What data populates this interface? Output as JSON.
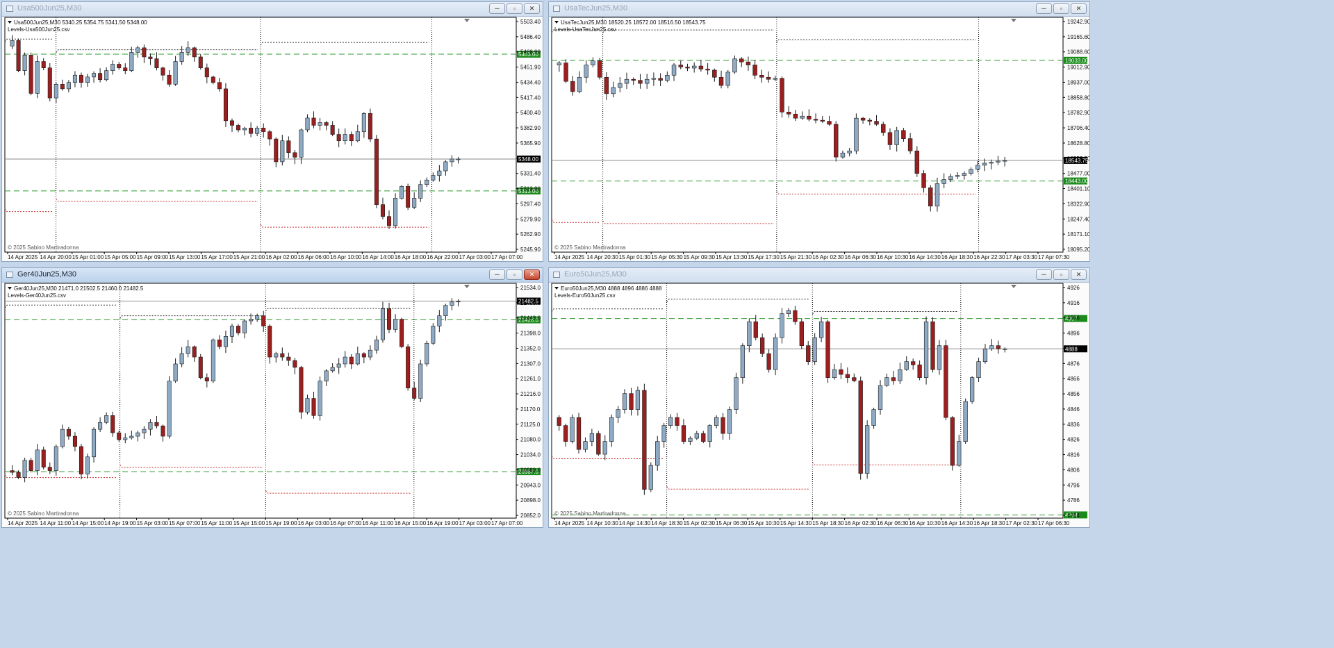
{
  "colors": {
    "bull_fill": "#8eaac4",
    "bear_fill": "#9b1f1f",
    "candle_outline": "#1a1a1a",
    "level_line": "#2e9a2e",
    "level_tag": "#1a8a1a",
    "price_tag": "#000000",
    "chart_bg": "#ffffff",
    "grid": "#000000",
    "upper_band": "#333333",
    "lower_band": "#c83030",
    "bid_line": "#8a8a8a"
  },
  "icons": {
    "window": "window-icon",
    "minimize": "minimize-icon",
    "restore": "restore-icon",
    "close": "close-icon",
    "menu": "triangle-down-icon"
  },
  "windows": [
    {
      "title": "Usa500Jun25,M30",
      "active": false,
      "buttons": {
        "min": "─",
        "max": "▫",
        "close": "✕"
      },
      "header": "Usa500Jun25,M30  5340.25 5354.75 5341.50 5348.00",
      "indicator": "Levels-Usa500Jun25.csv",
      "copyright": "© 2025 Sabino Martiradonna",
      "chart_data": {
        "type": "candlestick",
        "ylim": [
          5245.9,
          5503.4
        ],
        "yticks": [
          "5503.40",
          "5486.40",
          "5468.90",
          "5451.90",
          "5434.40",
          "5417.40",
          "5400.40",
          "5382.90",
          "5365.90",
          "5348.90",
          "5331.40",
          "5313.90",
          "5297.40",
          "5279.90",
          "5262.90",
          "5245.90"
        ],
        "xticks": [
          "14 Apr 2025",
          "14 Apr 20:00",
          "15 Apr 01:00",
          "15 Apr 05:00",
          "15 Apr 09:00",
          "15 Apr 13:00",
          "15 Apr 17:00",
          "15 Apr 21:00",
          "16 Apr 02:00",
          "16 Apr 06:00",
          "16 Apr 10:00",
          "16 Apr 14:00",
          "16 Apr 18:00",
          "16 Apr 22:00",
          "17 Apr 03:00",
          "17 Apr 07:00"
        ],
        "levels": [
          {
            "value": 5463.0,
            "label": "5463.00"
          },
          {
            "value": 5313.0,
            "label": "5313.00"
          }
        ],
        "last_price": {
          "value": 5348.0,
          "label": "5348.00"
        },
        "session_separators": [
          0.1,
          0.5,
          0.835
        ],
        "path": [
          5478,
          5445,
          5462,
          5420,
          5455,
          5448,
          5415,
          5430,
          5425,
          5432,
          5440,
          5432,
          5438,
          5442,
          5435,
          5445,
          5452,
          5448,
          5445,
          5465,
          5470,
          5460,
          5458,
          5448,
          5440,
          5430,
          5455,
          5465,
          5470,
          5460,
          5448,
          5438,
          5432,
          5425,
          5390,
          5385,
          5380,
          5382,
          5376,
          5382,
          5378,
          5370,
          5345,
          5368,
          5355,
          5350,
          5380,
          5393,
          5385,
          5388,
          5385,
          5375,
          5368,
          5375,
          5368,
          5378,
          5398,
          5370,
          5298,
          5285,
          5275,
          5305,
          5318,
          5295,
          5305,
          5320,
          5325,
          5330,
          5335,
          5345,
          5348,
          5348
        ],
        "first_open": 5472
      }
    },
    {
      "title": "UsaTecJun25,M30",
      "active": false,
      "buttons": {
        "min": "─",
        "max": "▫",
        "close": "✕"
      },
      "header": "UsaTecJun25,M30  18520.25 18572.00 18516.50 18543.75",
      "indicator": "Levels-UsaTecJun25.csv",
      "copyright": "© 2025 Sabino Martiradonna",
      "chart_data": {
        "type": "candlestick",
        "ylim": [
          18095.2,
          19242.9
        ],
        "yticks": [
          "19242.90",
          "19165.60",
          "19088.60",
          "19012.90",
          "18937.00",
          "18858.80",
          "18782.90",
          "18706.40",
          "18628.80",
          "18553.30",
          "18477.00",
          "18401.10",
          "18322.90",
          "18247.40",
          "18171.10",
          "18095.20"
        ],
        "xticks": [
          "14 Apr 2025",
          "14 Apr 20:30",
          "15 Apr 01:30",
          "15 Apr 05:30",
          "15 Apr 09:30",
          "15 Apr 13:30",
          "15 Apr 17:30",
          "15 Apr 21:30",
          "16 Apr 02:30",
          "16 Apr 06:30",
          "16 Apr 10:30",
          "16 Apr 14:30",
          "16 Apr 18:30",
          "16 Apr 22:30",
          "17 Apr 03:30",
          "17 Apr 07:30"
        ],
        "levels": [
          {
            "value": 19033.0,
            "label": "19033.00"
          },
          {
            "value": 18443.0,
            "label": "18443.00"
          }
        ],
        "last_price": {
          "value": 18543.75,
          "label": "18543.75"
        },
        "session_separators": [
          0.1,
          0.44,
          0.835
        ],
        "path": [
          19020,
          18930,
          18880,
          18950,
          19010,
          19030,
          18950,
          18870,
          18900,
          18920,
          18940,
          18935,
          18920,
          18940,
          18945,
          18935,
          18960,
          19010,
          19000,
          18995,
          19005,
          18990,
          18985,
          18950,
          18910,
          18975,
          19040,
          19025,
          19010,
          18960,
          18950,
          18940,
          18945,
          18780,
          18770,
          18750,
          18760,
          18745,
          18740,
          18735,
          18720,
          18560,
          18580,
          18590,
          18750,
          18740,
          18735,
          18720,
          18680,
          18620,
          18690,
          18650,
          18590,
          18480,
          18410,
          18320,
          18430,
          18450,
          18465,
          18470,
          18480,
          18500,
          18520,
          18530,
          18535,
          18540,
          18543
        ],
        "first_open": 19010
      }
    },
    {
      "title": "Ger40Jun25,M30",
      "active": true,
      "buttons": {
        "min": "─",
        "max": "▫",
        "close": "✕"
      },
      "header": "Ger40Jun25,M30  21471.0 21502.5 21460.0 21482.5",
      "indicator": "Levels-Ger40Jun25.csv",
      "copyright": "© 2025 Sabino Martiradonna",
      "chart_data": {
        "type": "candlestick",
        "ylim": [
          20852.0,
          21534.0
        ],
        "yticks": [
          "21534.0",
          "21488.0",
          "21443.0",
          "21398.0",
          "21352.0",
          "21307.0",
          "21261.0",
          "21216.0",
          "21170.0",
          "21125.0",
          "21080.0",
          "21034.0",
          "20989.0",
          "20943.0",
          "20898.0",
          "20852.0"
        ],
        "xticks": [
          "14 Apr 2025",
          "14 Apr 11:00",
          "14 Apr 15:00",
          "14 Apr 19:00",
          "15 Apr 03:00",
          "15 Apr 07:00",
          "15 Apr 11:00",
          "15 Apr 15:00",
          "15 Apr 19:00",
          "16 Apr 03:00",
          "16 Apr 07:00",
          "16 Apr 11:00",
          "16 Apr 15:00",
          "16 Apr 19:00",
          "17 Apr 03:00",
          "17 Apr 07:00"
        ],
        "levels": [
          {
            "value": 21428.0,
            "label": "21428.0"
          },
          {
            "value": 20987.0,
            "label": "20987.0"
          }
        ],
        "last_price": {
          "value": 21482.5,
          "label": "21482.5"
        },
        "session_separators": [
          0.225,
          0.51,
          0.8
        ],
        "path": [
          20985,
          20970,
          21020,
          20990,
          21050,
          21000,
          20990,
          21060,
          21110,
          21090,
          21060,
          20980,
          21030,
          21110,
          21130,
          21150,
          21100,
          21080,
          21085,
          21090,
          21100,
          21110,
          21130,
          21120,
          21090,
          21250,
          21300,
          21330,
          21350,
          21320,
          21260,
          21250,
          21370,
          21350,
          21380,
          21410,
          21390,
          21425,
          21430,
          21440,
          21410,
          21320,
          21330,
          21320,
          21310,
          21290,
          21160,
          21200,
          21150,
          21250,
          21280,
          21290,
          21300,
          21320,
          21300,
          21330,
          21320,
          21340,
          21370,
          21460,
          21400,
          21430,
          21350,
          21230,
          21200,
          21300,
          21360,
          21410,
          21440,
          21470,
          21480,
          21482
        ],
        "first_open": 20990
      }
    },
    {
      "title": "Euro50Jun25,M30",
      "active": false,
      "buttons": {
        "min": "─",
        "max": "▫",
        "close": "✕"
      },
      "header": "Euro50Jun25,M30  4888 4896 4886 4888",
      "indicator": "Levels-Euro50Jun25.csv",
      "copyright": "© 2025 Sabino Martiradonna",
      "chart_data": {
        "type": "candlestick",
        "ylim": [
          4782,
          4929
        ],
        "yticks": [
          "4926",
          "4916",
          "4906",
          "4896",
          "4886",
          "4876",
          "4866",
          "4856",
          "4846",
          "4836",
          "4826",
          "4816",
          "4806",
          "4796",
          "4786",
          "4784"
        ],
        "xticks": [
          "14 Apr 2025",
          "14 Apr 10:30",
          "14 Apr 14:30",
          "14 Apr 18:30",
          "15 Apr 02:30",
          "15 Apr 06:30",
          "15 Apr 10:30",
          "15 Apr 14:30",
          "15 Apr 18:30",
          "16 Apr 02:30",
          "16 Apr 06:30",
          "16 Apr 10:30",
          "16 Apr 14:30",
          "16 Apr 18:30",
          "17 Apr 02:30",
          "17 Apr 06:30"
        ],
        "levels": [
          {
            "value": 4907,
            "label": "4907"
          },
          {
            "value": 4784,
            "label": "4784"
          }
        ],
        "last_price": {
          "value": 4888,
          "label": "4888"
        },
        "session_separators": [
          0.225,
          0.51,
          0.8
        ],
        "path": [
          4840,
          4830,
          4845,
          4825,
          4830,
          4835,
          4822,
          4830,
          4845,
          4850,
          4860,
          4850,
          4862,
          4800,
          4815,
          4830,
          4840,
          4845,
          4840,
          4830,
          4832,
          4835,
          4830,
          4840,
          4845,
          4835,
          4850,
          4870,
          4890,
          4905,
          4895,
          4885,
          4875,
          4895,
          4910,
          4912,
          4905,
          4890,
          4880,
          4895,
          4905,
          4870,
          4875,
          4872,
          4870,
          4868,
          4810,
          4840,
          4850,
          4865,
          4870,
          4868,
          4875,
          4880,
          4878,
          4870,
          4905,
          4875,
          4890,
          4845,
          4815,
          4830,
          4855,
          4870,
          4880,
          4888,
          4890,
          4888,
          4888
        ],
        "first_open": 4845
      }
    }
  ]
}
